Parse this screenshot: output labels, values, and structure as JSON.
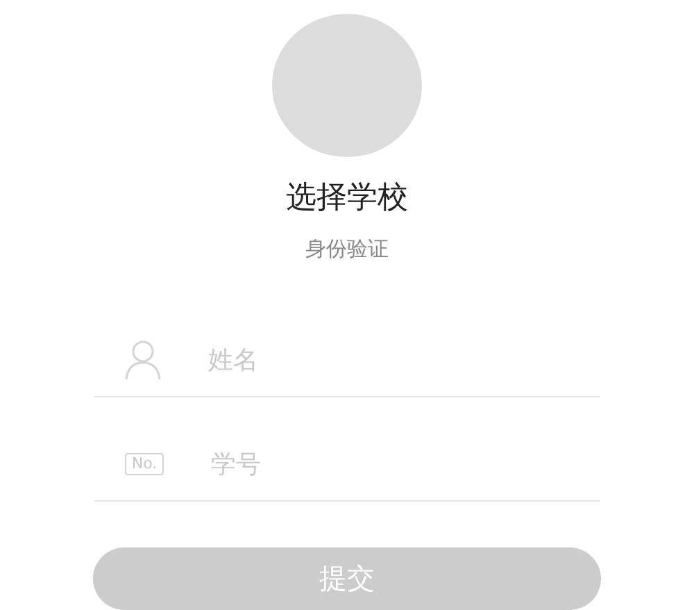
{
  "title": "选择学校",
  "subtitle": "身份验证",
  "fields": [
    {
      "kind": "person",
      "placeholder": "姓名"
    },
    {
      "kind": "number",
      "icon_text": "No.",
      "placeholder": "学号"
    }
  ],
  "submit": {
    "label": "提交",
    "disabled": true
  }
}
